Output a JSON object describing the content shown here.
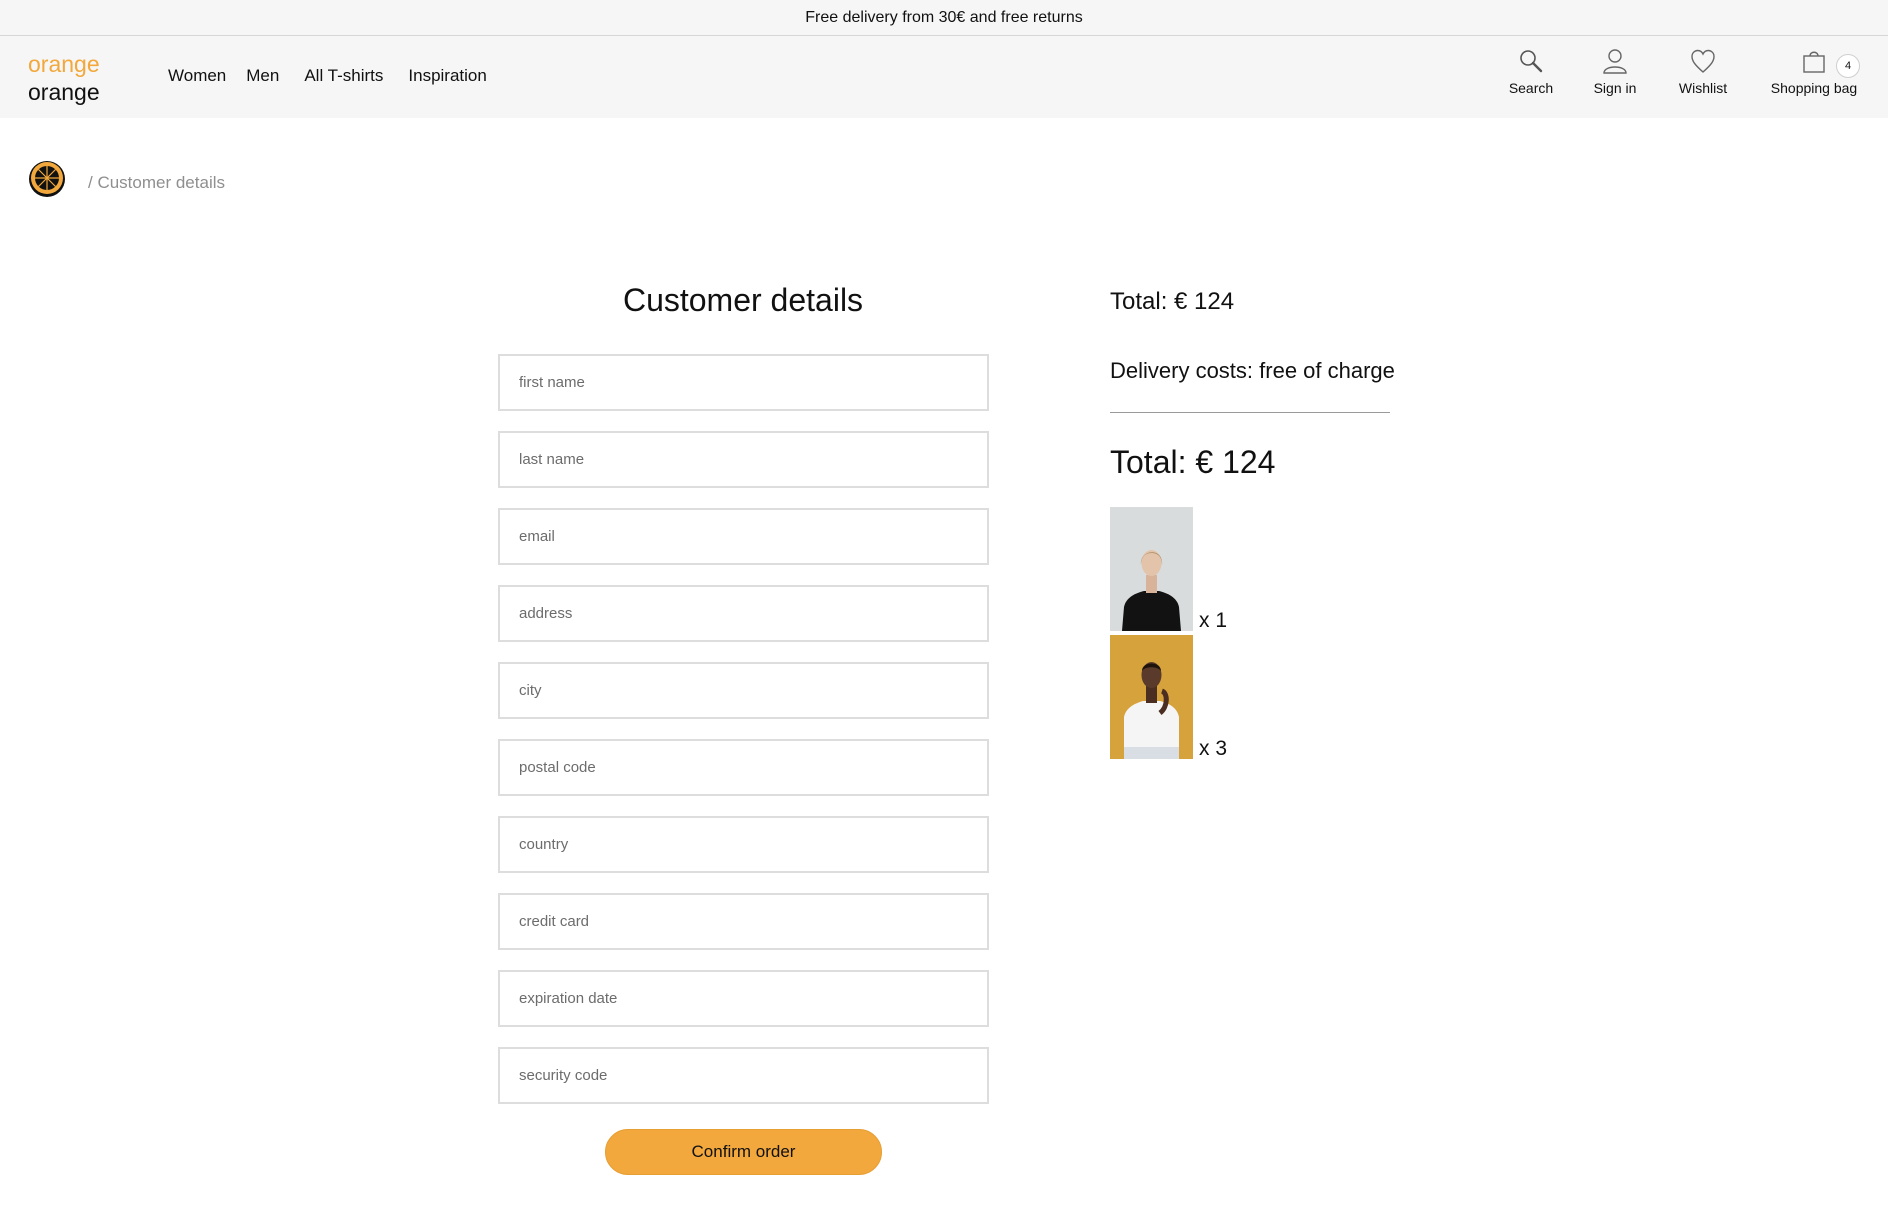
{
  "promo": {
    "text": "Free delivery from 30€ and free returns"
  },
  "brand": {
    "line1": "orange",
    "line2": "orange",
    "accent_color": "#f2a83c"
  },
  "nav": {
    "items": [
      "Women",
      "Men",
      "All T-shirts",
      "Inspiration"
    ]
  },
  "tools": {
    "search": {
      "label": "Search",
      "icon": "search-icon"
    },
    "signin": {
      "label": "Sign in",
      "icon": "user-icon"
    },
    "wishlist": {
      "label": "Wishlist",
      "icon": "heart-icon"
    },
    "bag": {
      "label": "Shopping bag",
      "icon": "shopping-bag-icon",
      "count": "4"
    }
  },
  "breadcrumb": {
    "home_icon": "orange-logo-icon",
    "current": "/ Customer details"
  },
  "form": {
    "title": "Customer details",
    "fields": [
      {
        "placeholder": "first name",
        "value": ""
      },
      {
        "placeholder": "last name",
        "value": ""
      },
      {
        "placeholder": "email",
        "value": ""
      },
      {
        "placeholder": "address",
        "value": ""
      },
      {
        "placeholder": "city",
        "value": ""
      },
      {
        "placeholder": "postal code",
        "value": ""
      },
      {
        "placeholder": "country",
        "value": ""
      },
      {
        "placeholder": "credit card",
        "value": ""
      },
      {
        "placeholder": "expiration date",
        "value": ""
      },
      {
        "placeholder": "security code",
        "value": ""
      }
    ],
    "submit_label": "Confirm order",
    "submit_color": "#f2a83c"
  },
  "summary": {
    "subtotal": "Total: € 124",
    "delivery": "Delivery costs: free of charge",
    "total": "Total: € 124",
    "items": [
      {
        "quantity": "x 1",
        "image": "woman in black t-shirt"
      },
      {
        "quantity": "x 3",
        "image": "man in white t-shirt"
      }
    ]
  }
}
